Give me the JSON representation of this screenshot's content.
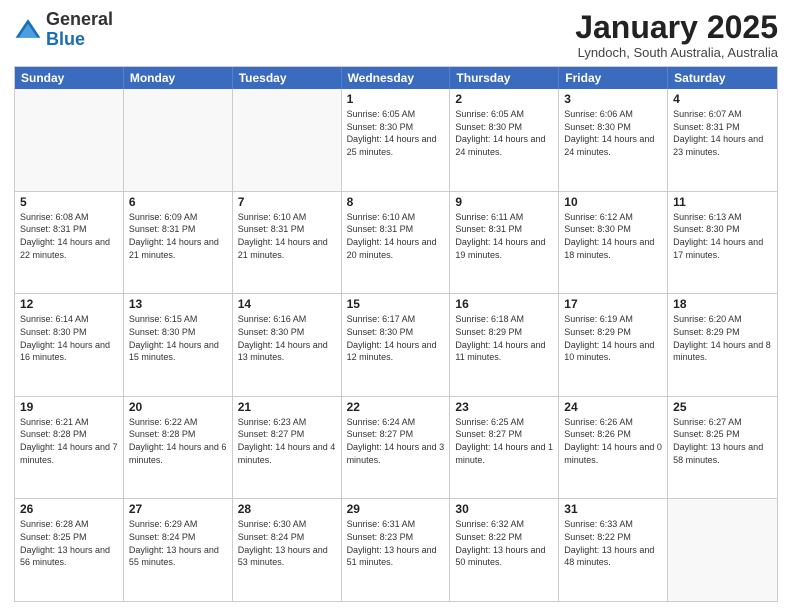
{
  "logo": {
    "general": "General",
    "blue": "Blue"
  },
  "header": {
    "month": "January 2025",
    "location": "Lyndoch, South Australia, Australia"
  },
  "weekdays": [
    "Sunday",
    "Monday",
    "Tuesday",
    "Wednesday",
    "Thursday",
    "Friday",
    "Saturday"
  ],
  "rows": [
    [
      {
        "day": "",
        "empty": true
      },
      {
        "day": "",
        "empty": true
      },
      {
        "day": "",
        "empty": true
      },
      {
        "day": "1",
        "sunrise": "Sunrise: 6:05 AM",
        "sunset": "Sunset: 8:30 PM",
        "daylight": "Daylight: 14 hours and 25 minutes."
      },
      {
        "day": "2",
        "sunrise": "Sunrise: 6:05 AM",
        "sunset": "Sunset: 8:30 PM",
        "daylight": "Daylight: 14 hours and 24 minutes."
      },
      {
        "day": "3",
        "sunrise": "Sunrise: 6:06 AM",
        "sunset": "Sunset: 8:30 PM",
        "daylight": "Daylight: 14 hours and 24 minutes."
      },
      {
        "day": "4",
        "sunrise": "Sunrise: 6:07 AM",
        "sunset": "Sunset: 8:31 PM",
        "daylight": "Daylight: 14 hours and 23 minutes."
      }
    ],
    [
      {
        "day": "5",
        "sunrise": "Sunrise: 6:08 AM",
        "sunset": "Sunset: 8:31 PM",
        "daylight": "Daylight: 14 hours and 22 minutes."
      },
      {
        "day": "6",
        "sunrise": "Sunrise: 6:09 AM",
        "sunset": "Sunset: 8:31 PM",
        "daylight": "Daylight: 14 hours and 21 minutes."
      },
      {
        "day": "7",
        "sunrise": "Sunrise: 6:10 AM",
        "sunset": "Sunset: 8:31 PM",
        "daylight": "Daylight: 14 hours and 21 minutes."
      },
      {
        "day": "8",
        "sunrise": "Sunrise: 6:10 AM",
        "sunset": "Sunset: 8:31 PM",
        "daylight": "Daylight: 14 hours and 20 minutes."
      },
      {
        "day": "9",
        "sunrise": "Sunrise: 6:11 AM",
        "sunset": "Sunset: 8:31 PM",
        "daylight": "Daylight: 14 hours and 19 minutes."
      },
      {
        "day": "10",
        "sunrise": "Sunrise: 6:12 AM",
        "sunset": "Sunset: 8:30 PM",
        "daylight": "Daylight: 14 hours and 18 minutes."
      },
      {
        "day": "11",
        "sunrise": "Sunrise: 6:13 AM",
        "sunset": "Sunset: 8:30 PM",
        "daylight": "Daylight: 14 hours and 17 minutes."
      }
    ],
    [
      {
        "day": "12",
        "sunrise": "Sunrise: 6:14 AM",
        "sunset": "Sunset: 8:30 PM",
        "daylight": "Daylight: 14 hours and 16 minutes."
      },
      {
        "day": "13",
        "sunrise": "Sunrise: 6:15 AM",
        "sunset": "Sunset: 8:30 PM",
        "daylight": "Daylight: 14 hours and 15 minutes."
      },
      {
        "day": "14",
        "sunrise": "Sunrise: 6:16 AM",
        "sunset": "Sunset: 8:30 PM",
        "daylight": "Daylight: 14 hours and 13 minutes."
      },
      {
        "day": "15",
        "sunrise": "Sunrise: 6:17 AM",
        "sunset": "Sunset: 8:30 PM",
        "daylight": "Daylight: 14 hours and 12 minutes."
      },
      {
        "day": "16",
        "sunrise": "Sunrise: 6:18 AM",
        "sunset": "Sunset: 8:29 PM",
        "daylight": "Daylight: 14 hours and 11 minutes."
      },
      {
        "day": "17",
        "sunrise": "Sunrise: 6:19 AM",
        "sunset": "Sunset: 8:29 PM",
        "daylight": "Daylight: 14 hours and 10 minutes."
      },
      {
        "day": "18",
        "sunrise": "Sunrise: 6:20 AM",
        "sunset": "Sunset: 8:29 PM",
        "daylight": "Daylight: 14 hours and 8 minutes."
      }
    ],
    [
      {
        "day": "19",
        "sunrise": "Sunrise: 6:21 AM",
        "sunset": "Sunset: 8:28 PM",
        "daylight": "Daylight: 14 hours and 7 minutes."
      },
      {
        "day": "20",
        "sunrise": "Sunrise: 6:22 AM",
        "sunset": "Sunset: 8:28 PM",
        "daylight": "Daylight: 14 hours and 6 minutes."
      },
      {
        "day": "21",
        "sunrise": "Sunrise: 6:23 AM",
        "sunset": "Sunset: 8:27 PM",
        "daylight": "Daylight: 14 hours and 4 minutes."
      },
      {
        "day": "22",
        "sunrise": "Sunrise: 6:24 AM",
        "sunset": "Sunset: 8:27 PM",
        "daylight": "Daylight: 14 hours and 3 minutes."
      },
      {
        "day": "23",
        "sunrise": "Sunrise: 6:25 AM",
        "sunset": "Sunset: 8:27 PM",
        "daylight": "Daylight: 14 hours and 1 minute."
      },
      {
        "day": "24",
        "sunrise": "Sunrise: 6:26 AM",
        "sunset": "Sunset: 8:26 PM",
        "daylight": "Daylight: 14 hours and 0 minutes."
      },
      {
        "day": "25",
        "sunrise": "Sunrise: 6:27 AM",
        "sunset": "Sunset: 8:25 PM",
        "daylight": "Daylight: 13 hours and 58 minutes."
      }
    ],
    [
      {
        "day": "26",
        "sunrise": "Sunrise: 6:28 AM",
        "sunset": "Sunset: 8:25 PM",
        "daylight": "Daylight: 13 hours and 56 minutes."
      },
      {
        "day": "27",
        "sunrise": "Sunrise: 6:29 AM",
        "sunset": "Sunset: 8:24 PM",
        "daylight": "Daylight: 13 hours and 55 minutes."
      },
      {
        "day": "28",
        "sunrise": "Sunrise: 6:30 AM",
        "sunset": "Sunset: 8:24 PM",
        "daylight": "Daylight: 13 hours and 53 minutes."
      },
      {
        "day": "29",
        "sunrise": "Sunrise: 6:31 AM",
        "sunset": "Sunset: 8:23 PM",
        "daylight": "Daylight: 13 hours and 51 minutes."
      },
      {
        "day": "30",
        "sunrise": "Sunrise: 6:32 AM",
        "sunset": "Sunset: 8:22 PM",
        "daylight": "Daylight: 13 hours and 50 minutes."
      },
      {
        "day": "31",
        "sunrise": "Sunrise: 6:33 AM",
        "sunset": "Sunset: 8:22 PM",
        "daylight": "Daylight: 13 hours and 48 minutes."
      },
      {
        "day": "",
        "empty": true
      }
    ]
  ]
}
